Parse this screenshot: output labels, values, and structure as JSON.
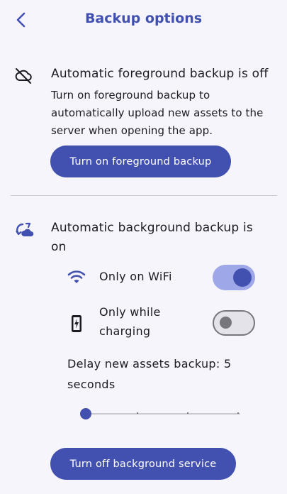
{
  "header": {
    "title": "Backup options",
    "back_icon": "chevron-left-icon"
  },
  "foreground": {
    "icon": "cloud-off-icon",
    "title": "Automatic foreground backup is off",
    "description": "Turn on foreground backup to automatically upload new assets to the server when opening the app.",
    "button_label": "Turn on foreground backup"
  },
  "background": {
    "icon": "cloud-sync-icon",
    "title": "Automatic background backup is on",
    "options": [
      {
        "label": "Only on WiFi",
        "icon": "wifi-icon",
        "enabled": true
      },
      {
        "label": "Only while charging",
        "icon": "battery-charging-icon",
        "enabled": false
      }
    ],
    "delay_label": "Delay new assets backup: 5 seconds",
    "delay_slider": {
      "value": 0,
      "steps": 4
    },
    "button_label": "Turn off background service"
  },
  "colors": {
    "accent": "#4250af",
    "accent_light": "#9ea7e8",
    "background": "#f5f5fb"
  }
}
